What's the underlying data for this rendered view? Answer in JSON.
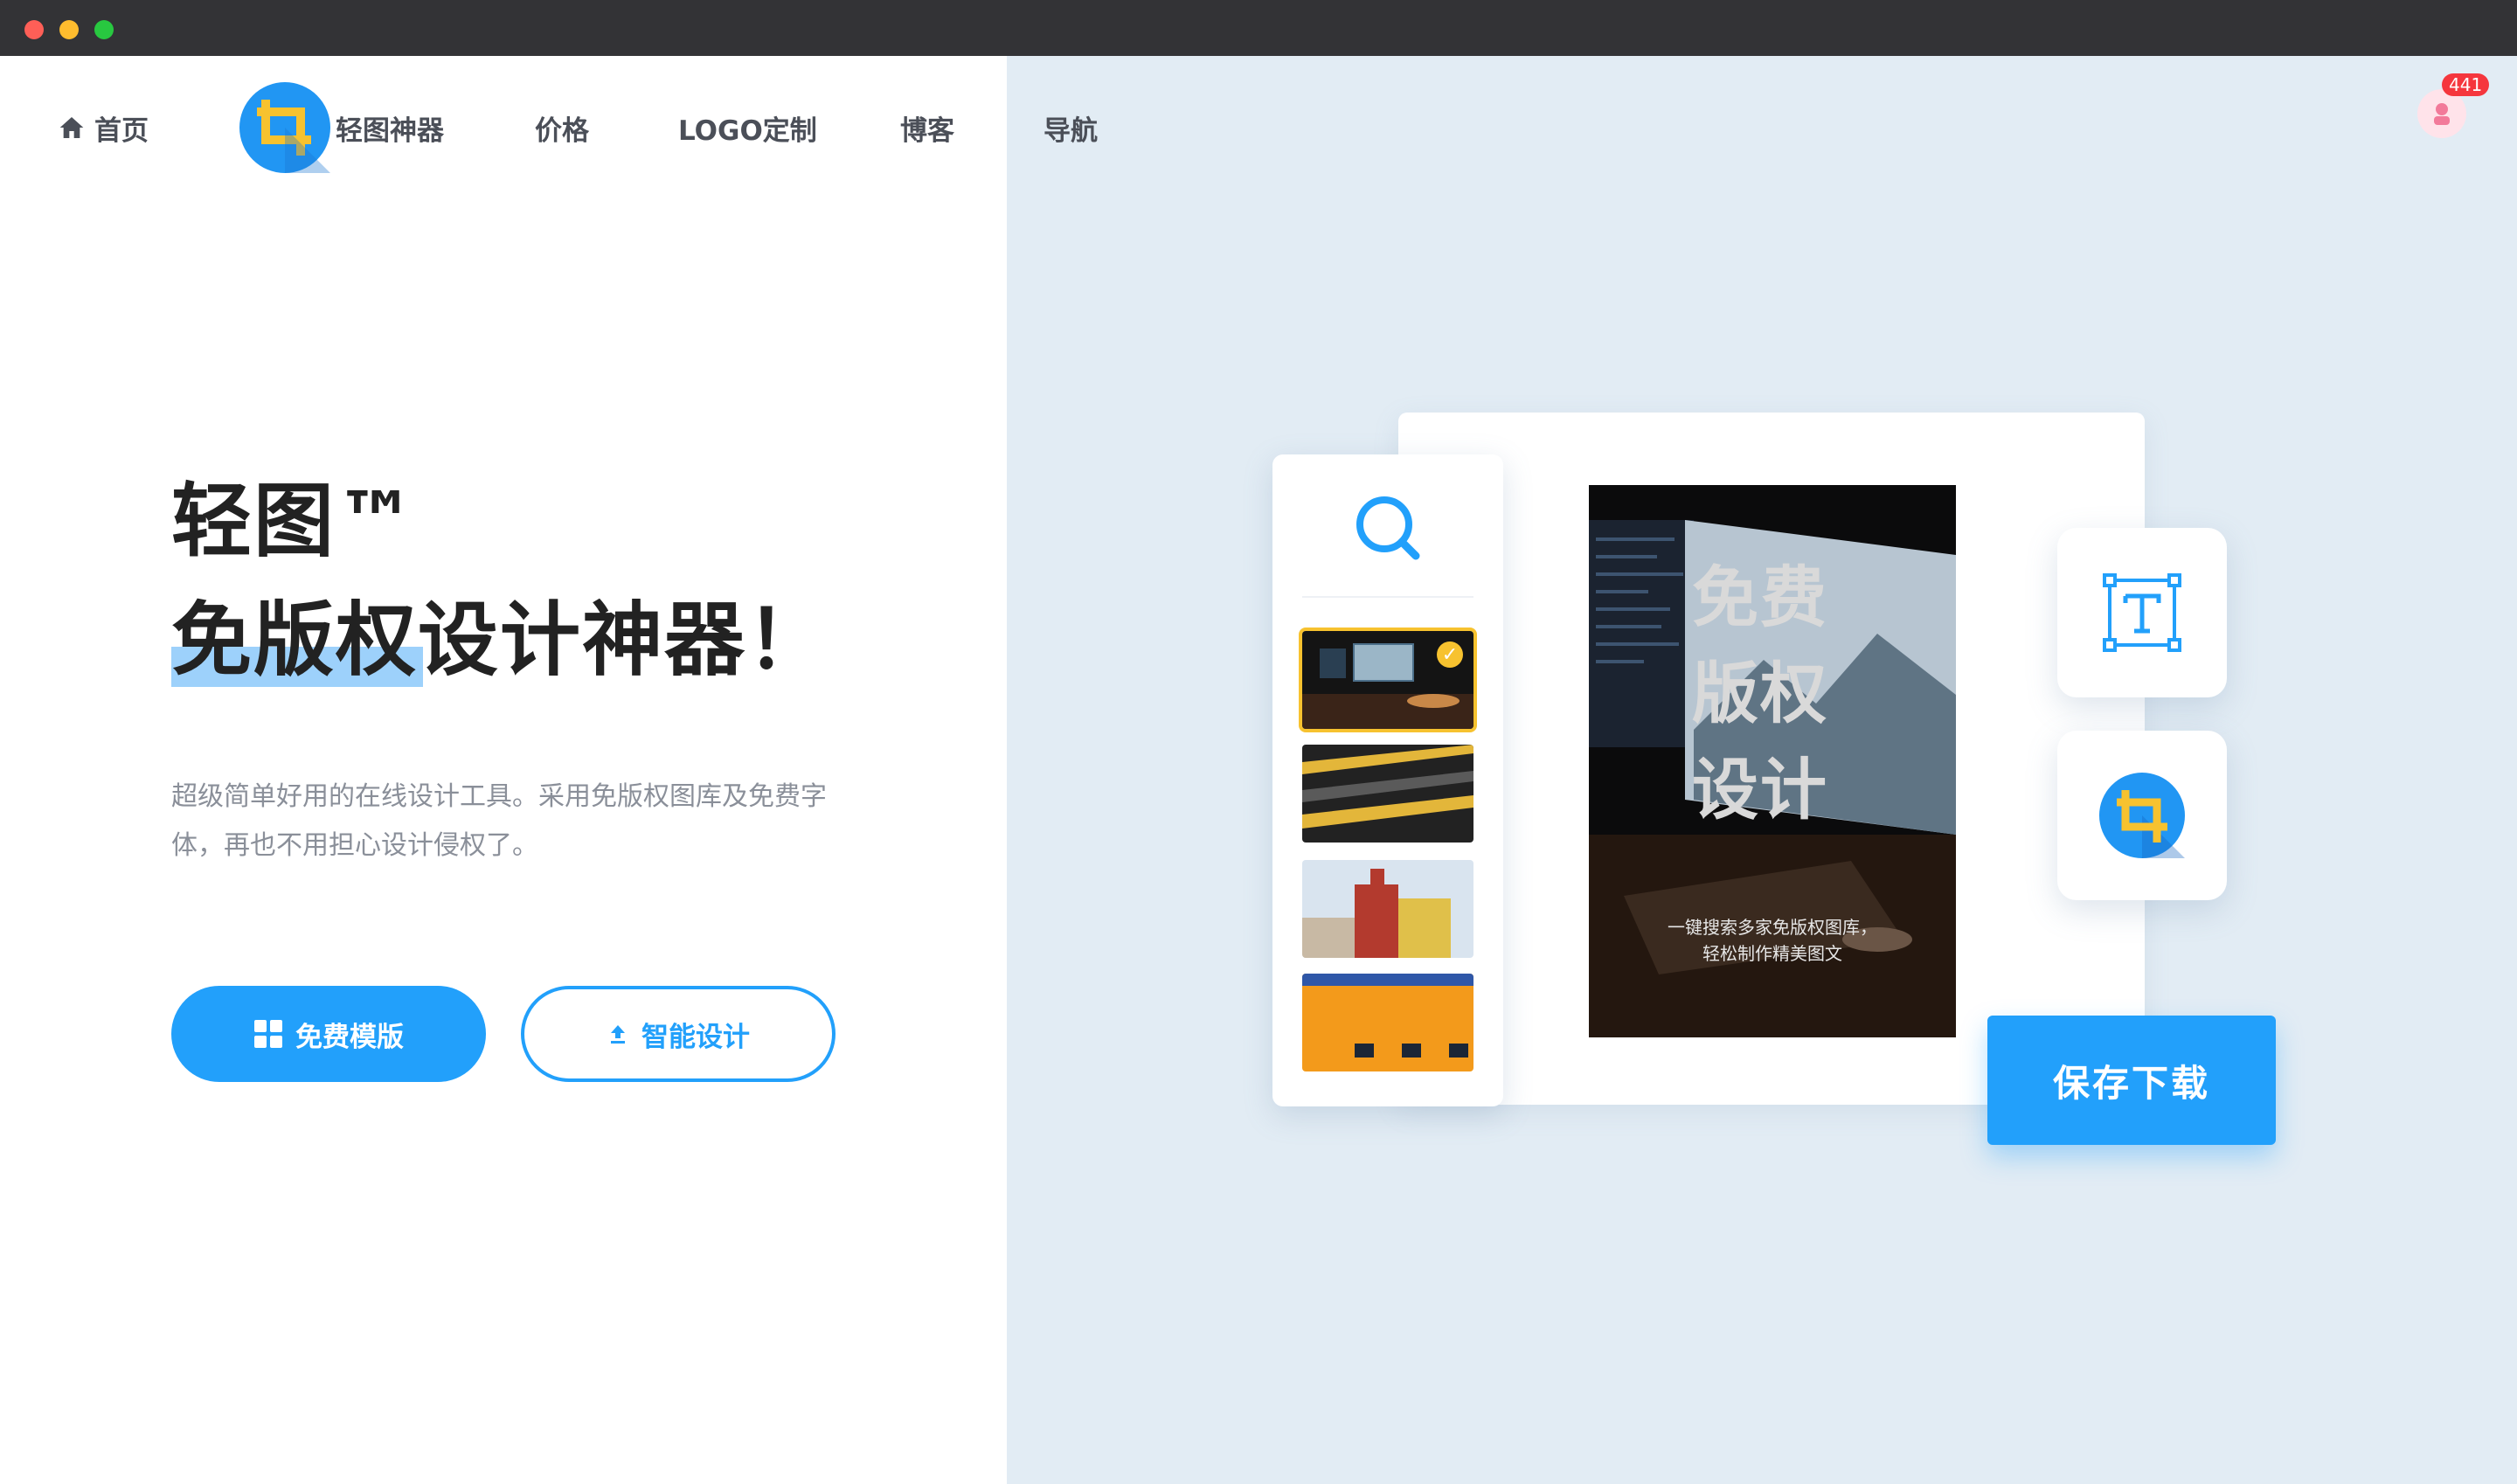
{
  "nav": {
    "home": "首页",
    "brand": "轻图神器",
    "pricing": "价格",
    "logo_custom": "LOGO定制",
    "blog": "博客",
    "guide": "导航"
  },
  "hero": {
    "title_line1": "轻图™",
    "title_line2": "免版权设计神器！",
    "description": "超级简单好用的在线设计工具。采用免版权图库及免费字体，再也不用担心设计侵权了。",
    "btn_templates": "免费模版",
    "btn_smart_design": "智能设计"
  },
  "illustration": {
    "poster_line1": "免费",
    "poster_line2": "版权",
    "poster_line3": "设计",
    "poster_sub1": "一键搜索多家免版权图库，",
    "poster_sub2": "轻松制作精美图文",
    "save_button": "保存下载"
  },
  "user": {
    "notification_count": "441"
  },
  "colors": {
    "accent": "#22a0fb",
    "highlight": "#9dd1fb",
    "right_bg": "#e2ecf4",
    "selected_thumb": "#f7c22f"
  }
}
